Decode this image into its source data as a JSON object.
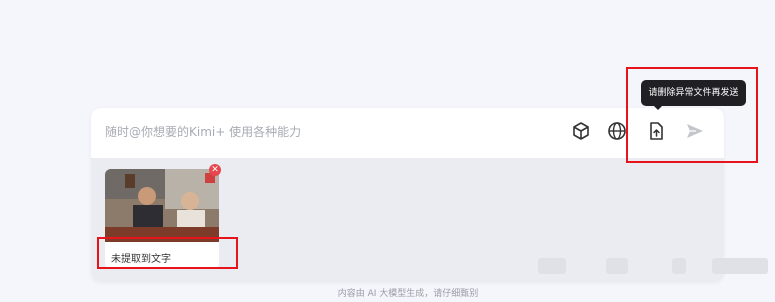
{
  "composer": {
    "placeholder": "随时@你想要的Kimi+ 使用各种能力",
    "tools": [
      {
        "icon": "cube-icon"
      },
      {
        "icon": "globe-icon"
      },
      {
        "icon": "file-upload-icon"
      },
      {
        "icon": "send-icon"
      }
    ]
  },
  "attachment": {
    "status": "未提取到文字",
    "thumbnail_icon": "photo-thumbnail"
  },
  "tooltip": {
    "text": "请删除异常文件再发送"
  },
  "footer": {
    "disclaimer": "内容由 AI 大模型生成，请仔细甄别"
  },
  "colors": {
    "highlight": "#e8141c",
    "remove": "#e5484d",
    "tooltip_bg": "#1f1f24"
  }
}
